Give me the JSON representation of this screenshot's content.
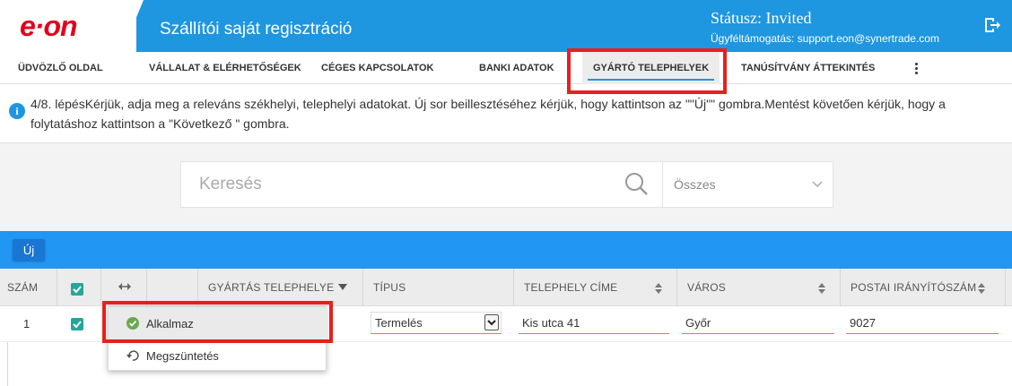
{
  "header": {
    "logo_text": "e·on",
    "title": "Szállítói saját regisztráció",
    "status": "Státusz: Invited",
    "support": "Ügyféltámogatás: support.eon@synertrade.com",
    "logout_icon": "logout-icon"
  },
  "nav": {
    "tabs": [
      {
        "label": "ÜDVÖZLŐ OLDAL"
      },
      {
        "label": "VÁLLALAT & ELÉRHETŐSÉGEK"
      },
      {
        "label": "CÉGES KAPCSOLATOK"
      },
      {
        "label": "BANKI ADATOK"
      },
      {
        "label": "GYÁRTÓ TELEPHELYEK"
      },
      {
        "label": "TANÚSÍTVÁNY ÁTTEKINTÉS"
      }
    ],
    "active_tab": "GYÁRTÓ TELEPHELYEK"
  },
  "info": {
    "text": "4/8. lépésKérjük, adja meg a releváns székhelyi, telephelyi adatokat. Új sor beillesztéséhez kérjük, hogy kattintson az \"\"Új\"\" gombra.Mentést követően kérjük, hogy a folytatáshoz kattintson a \"Következő \" gombra."
  },
  "search": {
    "placeholder": "Keresés",
    "filter_value": "Összes"
  },
  "toolbar": {
    "new_label": "Új"
  },
  "table": {
    "headers": {
      "num": "SZÁM",
      "site": "GYÁRTÁS TELEPHELYE",
      "type": "TÍPUS",
      "address": "TELEPHELY CÍME",
      "city": "VÁROS",
      "zip": "POSTAI IRÁNYÍTÓSZÁM"
    },
    "rows": [
      {
        "num": "1",
        "type": "Termelés",
        "address": "Kis utca 41",
        "city": "Győr",
        "zip": "9027"
      }
    ]
  },
  "context_menu": {
    "apply": "Alkalmaz",
    "cancel": "Megszüntetés"
  },
  "colors": {
    "brand_blue": "#1e96e0",
    "toolbar_blue": "#2196f3",
    "eon_red": "#e2001a",
    "highlight_red": "#e8201c",
    "checkbox_teal": "#26a69a"
  }
}
